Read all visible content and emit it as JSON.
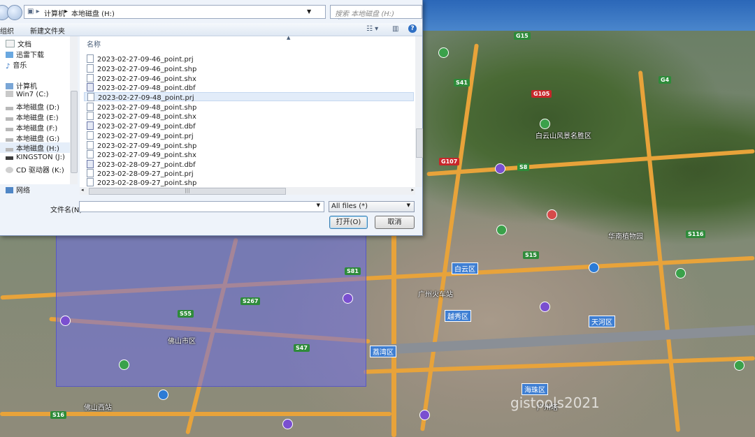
{
  "dialog": {
    "breadcrumb": [
      "计算机",
      "本地磁盘 (H:)"
    ],
    "search_placeholder": "搜索 本地磁盘 (H:)",
    "toolbar": {
      "organize": "组织",
      "new_folder": "新建文件夹"
    },
    "nav_items": [
      {
        "label": "文档",
        "icon": "documents-icon"
      },
      {
        "label": "迅雷下载",
        "icon": "download-folder-icon"
      },
      {
        "label": "音乐",
        "icon": "music-icon"
      },
      {
        "label": "计算机",
        "icon": "computer-icon"
      },
      {
        "label": "Win7 (C:)",
        "icon": "drive-icon"
      },
      {
        "label": "本地磁盘 (D:)",
        "icon": "drive-icon"
      },
      {
        "label": "本地磁盘 (E:)",
        "icon": "drive-icon"
      },
      {
        "label": "本地磁盘 (F:)",
        "icon": "drive-icon"
      },
      {
        "label": "本地磁盘 (G:)",
        "icon": "drive-icon"
      },
      {
        "label": "本地磁盘 (H:)",
        "icon": "drive-icon"
      },
      {
        "label": "KINGSTON (J:)",
        "icon": "usb-drive-icon"
      },
      {
        "label": "CD 驱动器 (K:)",
        "icon": "cd-drive-icon"
      },
      {
        "label": "网络",
        "icon": "network-icon"
      }
    ],
    "column_header": "名称",
    "files": [
      "2023-02-27-09-46_point.prj",
      "2023-02-27-09-46_point.shp",
      "2023-02-27-09-46_point.shx",
      "2023-02-27-09-48_point.dbf",
      "2023-02-27-09-48_point.prj",
      "2023-02-27-09-48_point.shp",
      "2023-02-27-09-48_point.shx",
      "2023-02-27-09-49_point.dbf",
      "2023-02-27-09-49_point.prj",
      "2023-02-27-09-49_point.shp",
      "2023-02-27-09-49_point.shx",
      "2023-02-28-09-27_point.dbf",
      "2023-02-28-09-27_point.prj",
      "2023-02-28-09-27_point.shp"
    ],
    "selected_file_index": 4,
    "filename_label": "文件名(N):",
    "filename_value": "",
    "filetype_value": "All files  (*)",
    "open_button": "打开(O)",
    "cancel_button": "取消"
  },
  "map": {
    "districts": [
      "白云区",
      "越秀区",
      "天河区",
      "荔湾区",
      "海珠区"
    ],
    "places": [
      "白云山风景名胜区",
      "广州塔",
      "佛山市区",
      "佛山西站",
      "华南植物园",
      "广州火车站"
    ],
    "routes": [
      "G15",
      "G4",
      "G105",
      "S41",
      "G107",
      "S8",
      "S55",
      "S267",
      "S81",
      "S15",
      "S47",
      "S116",
      "S16"
    ],
    "watermark": "gistools2021"
  }
}
